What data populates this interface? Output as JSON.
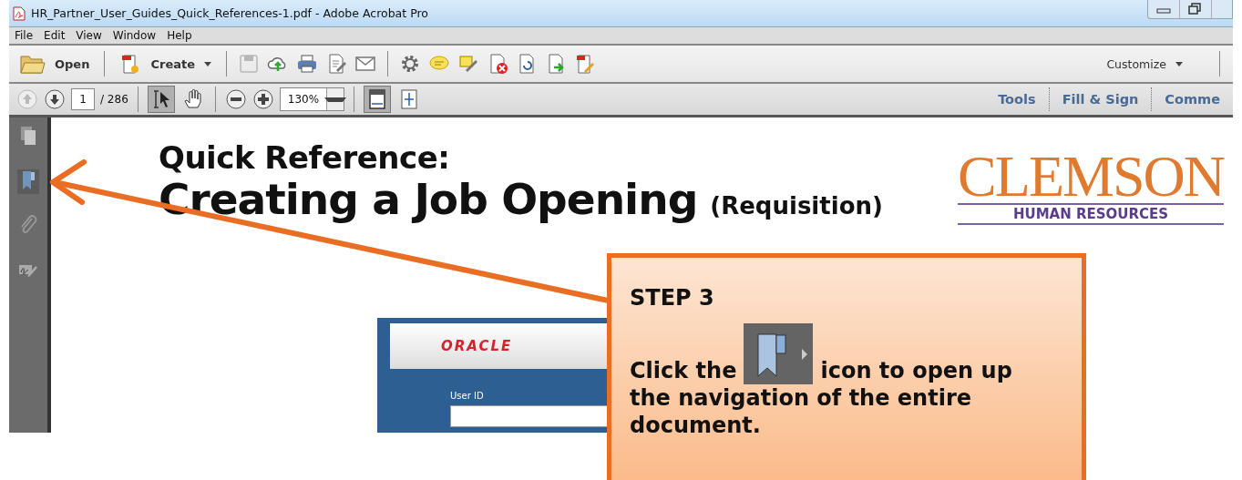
{
  "window": {
    "title": "HR_Partner_User_Guides_Quick_References-1.pdf - Adobe Acrobat Pro"
  },
  "menu": [
    "File",
    "Edit",
    "View",
    "Window",
    "Help"
  ],
  "toolbar": {
    "open": "Open",
    "create": "Create",
    "customize": "Customize",
    "tools": [
      {
        "kind": "save",
        "disabled": true
      },
      {
        "kind": "cloud",
        "disabled": false
      },
      {
        "kind": "print",
        "disabled": false
      },
      {
        "kind": "edit",
        "disabled": false
      },
      {
        "kind": "mail",
        "disabled": false
      },
      {
        "kind": "gear",
        "disabled": false
      },
      {
        "kind": "comment",
        "disabled": false
      },
      {
        "kind": "highlight",
        "disabled": false
      },
      {
        "kind": "delete",
        "disabled": false
      },
      {
        "kind": "refresh",
        "disabled": false
      },
      {
        "kind": "export",
        "disabled": false
      },
      {
        "kind": "sign",
        "disabled": false
      }
    ]
  },
  "navbar": {
    "previous_disabled": true,
    "page": "1",
    "total": "/ 286",
    "zoom": "130%",
    "modes": [
      {
        "kind": "select",
        "selected": true
      },
      {
        "kind": "hand",
        "selected": false
      }
    ],
    "fits": [
      {
        "kind": "fit-page",
        "selected": true
      },
      {
        "kind": "fit-screen",
        "selected": false
      }
    ],
    "panels": [
      "Tools",
      "Fill & Sign",
      "Comme"
    ]
  },
  "sidebar": [
    {
      "kind": "pages",
      "selected": false
    },
    {
      "kind": "bookmarks",
      "selected": true
    },
    {
      "kind": "attachments",
      "selected": false
    },
    {
      "kind": "signatures",
      "selected": false
    }
  ],
  "document": {
    "kicker": "Quick Reference:",
    "title": "Creating a Job Opening",
    "title_note": "(Requisition)",
    "logo": {
      "name": "CLEMSON",
      "subtitle": "HUMAN RESOURCES"
    },
    "screenshot": {
      "logo": "ORACLE",
      "field_label": "User ID"
    }
  },
  "callout": {
    "step": "STEP 3",
    "before": "Click the",
    "after": "icon to open up",
    "after_rest": "the navigation of the entire document."
  }
}
